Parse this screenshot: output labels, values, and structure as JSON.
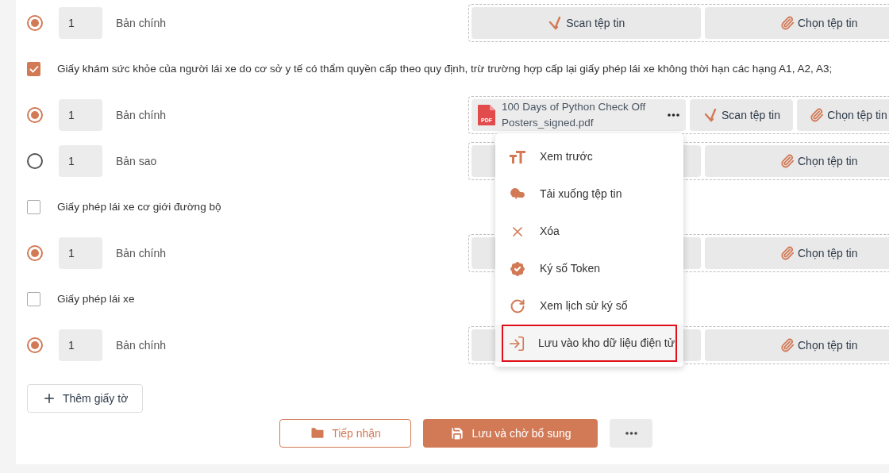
{
  "rows": [
    {
      "kind": "copy",
      "selected": true,
      "quantity": "1",
      "label": "Bản chính",
      "buttons": [
        {
          "kind": "scan",
          "label": "Scan tệp tin"
        },
        {
          "kind": "choose",
          "label": "Chọn tệp tin"
        }
      ]
    },
    {
      "kind": "document",
      "checked": true,
      "label": "Giấy khám sức khỏe của người lái xe do cơ sở y tế có thẩm quyền cấp theo quy định, trừ trường hợp cấp lại giấy phép lái xe không thời hạn các hạng A1, A2, A3;"
    },
    {
      "kind": "copy",
      "selected": true,
      "quantity": "1",
      "label": "Bản chính",
      "file": {
        "type_label": "PDF",
        "name": "100 Days of Python Check Off Posters_signed.pdf"
      },
      "buttons": [
        {
          "kind": "scan",
          "label": "Scan tệp tin"
        },
        {
          "kind": "choose",
          "label": "Chọn tệp tin"
        }
      ]
    },
    {
      "kind": "copy",
      "selected": false,
      "quantity": "1",
      "label": "Bản sao",
      "buttons": [
        {
          "kind": "covered"
        },
        {
          "kind": "choose",
          "label": "Chọn tệp tin"
        }
      ]
    },
    {
      "kind": "document",
      "checked": false,
      "label": "Giấy phép lái xe cơ giới đường bộ"
    },
    {
      "kind": "copy",
      "selected": true,
      "quantity": "1",
      "label": "Bản chính",
      "buttons": [
        {
          "kind": "covered"
        },
        {
          "kind": "choose",
          "label": "Chọn tệp tin"
        }
      ]
    },
    {
      "kind": "document",
      "checked": false,
      "label": "Giấy phép lái xe"
    },
    {
      "kind": "copy",
      "selected": true,
      "quantity": "1",
      "label": "Bản chính",
      "buttons": [
        {
          "kind": "covered"
        },
        {
          "kind": "choose",
          "label": "Chọn tệp tin"
        }
      ]
    }
  ],
  "file_menu": {
    "items": [
      {
        "kind": "preview",
        "label": "Xem trước",
        "selected": false
      },
      {
        "kind": "download",
        "label": "Tải xuống tệp tin",
        "selected": false
      },
      {
        "kind": "delete",
        "label": "Xóa",
        "selected": false
      },
      {
        "kind": "sign",
        "label": "Ký số Token",
        "selected": false
      },
      {
        "kind": "history",
        "label": "Xem lịch sử ký số",
        "selected": false
      },
      {
        "kind": "save",
        "label": "Lưu vào kho dữ liệu điện tử",
        "selected": true
      }
    ]
  },
  "add_button": "Thêm giấy tờ",
  "actions": [
    {
      "kind": "outline",
      "label": "Tiếp nhận"
    },
    {
      "kind": "primary",
      "label": "Lưu và chờ bổ sung"
    },
    {
      "kind": "more"
    }
  ]
}
